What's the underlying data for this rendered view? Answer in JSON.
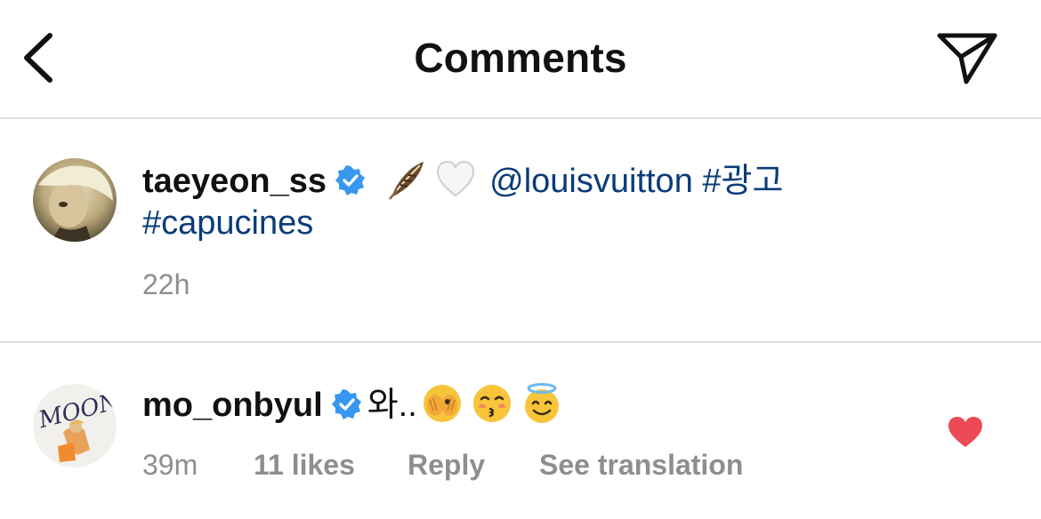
{
  "header": {
    "title": "Comments",
    "back_icon": "chevron-left-icon",
    "send_icon": "paper-plane-icon"
  },
  "post": {
    "username": "taeyeon_ss",
    "verified": true,
    "emojis": [
      "feather",
      "white-heart"
    ],
    "mention": "@louisvuitton",
    "hashtag_1": "#광고",
    "hashtag_2": "#capucines",
    "time": "22h"
  },
  "comment": {
    "username": "mo_onbyul",
    "verified": true,
    "text": "와..",
    "emojis": [
      "face-with-peeking-eye",
      "kissing-face-with-closed-eyes",
      "smiling-face-with-halo"
    ],
    "time": "39m",
    "likes": "11 likes",
    "reply_label": "Reply",
    "translate_label": "See translation",
    "liked": true
  },
  "colors": {
    "link": "#0a3b7a",
    "meta": "#8e8e8e",
    "verified": "#3897f0",
    "heart": "#ed4956",
    "divider": "#dcdcdc"
  }
}
